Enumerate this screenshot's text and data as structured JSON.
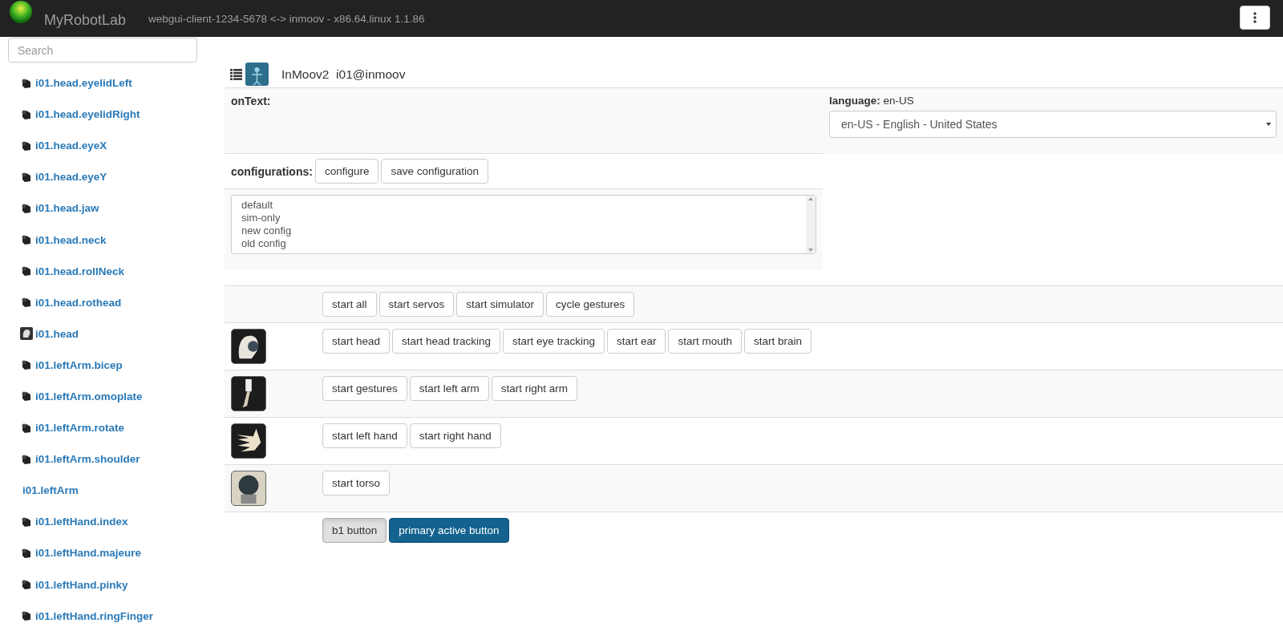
{
  "navbar": {
    "brand": "MyRobotLab",
    "connection": "webgui-client-1234-5678 <-> inmoov - x86.64.linux 1.1.86"
  },
  "sidebar": {
    "search": {
      "placeholder": "Search"
    },
    "items": [
      {
        "label": "i01.head.eyelidLeft",
        "kind": "servo"
      },
      {
        "label": "i01.head.eyelidRight",
        "kind": "servo"
      },
      {
        "label": "i01.head.eyeX",
        "kind": "servo"
      },
      {
        "label": "i01.head.eyeY",
        "kind": "servo"
      },
      {
        "label": "i01.head.jaw",
        "kind": "servo"
      },
      {
        "label": "i01.head.neck",
        "kind": "servo"
      },
      {
        "label": "i01.head.rollNeck",
        "kind": "servo"
      },
      {
        "label": "i01.head.rothead",
        "kind": "servo"
      },
      {
        "label": "i01.head",
        "kind": "head"
      },
      {
        "label": "i01.leftArm.bicep",
        "kind": "servo"
      },
      {
        "label": "i01.leftArm.omoplate",
        "kind": "servo"
      },
      {
        "label": "i01.leftArm.rotate",
        "kind": "servo"
      },
      {
        "label": "i01.leftArm.shoulder",
        "kind": "servo"
      },
      {
        "label": "i01.leftArm",
        "kind": "none"
      },
      {
        "label": "i01.leftHand.index",
        "kind": "servo"
      },
      {
        "label": "i01.leftHand.majeure",
        "kind": "servo"
      },
      {
        "label": "i01.leftHand.pinky",
        "kind": "servo"
      },
      {
        "label": "i01.leftHand.ringFinger",
        "kind": "servo"
      }
    ]
  },
  "service": {
    "type": "InMoov2",
    "name": "i01@inmoov",
    "on_text_label": "onText:",
    "language": {
      "label": "language:",
      "value": "en-US",
      "dropdown": "en-US - English - United States"
    },
    "configurations": {
      "label": "configurations:",
      "buttons": [
        "configure",
        "save configuration"
      ],
      "list": [
        "default",
        "sim-only",
        "new config",
        "old config"
      ]
    },
    "rows": [
      {
        "kind": "plain",
        "buttons": [
          "start all",
          "start servos",
          "start simulator",
          "cycle gestures"
        ]
      },
      {
        "kind": "head",
        "buttons": [
          "start head",
          "start head tracking",
          "start eye tracking",
          "start ear",
          "start mouth",
          "start brain"
        ]
      },
      {
        "kind": "arm",
        "buttons": [
          "start gestures",
          "start left arm",
          "start right arm"
        ]
      },
      {
        "kind": "hand",
        "buttons": [
          "start left hand",
          "start right hand"
        ]
      },
      {
        "kind": "torso",
        "buttons": [
          "start torso"
        ]
      }
    ],
    "footer_buttons": [
      {
        "label": "b1 button",
        "kind": "default"
      },
      {
        "label": "primary active button",
        "kind": "primary"
      }
    ]
  }
}
